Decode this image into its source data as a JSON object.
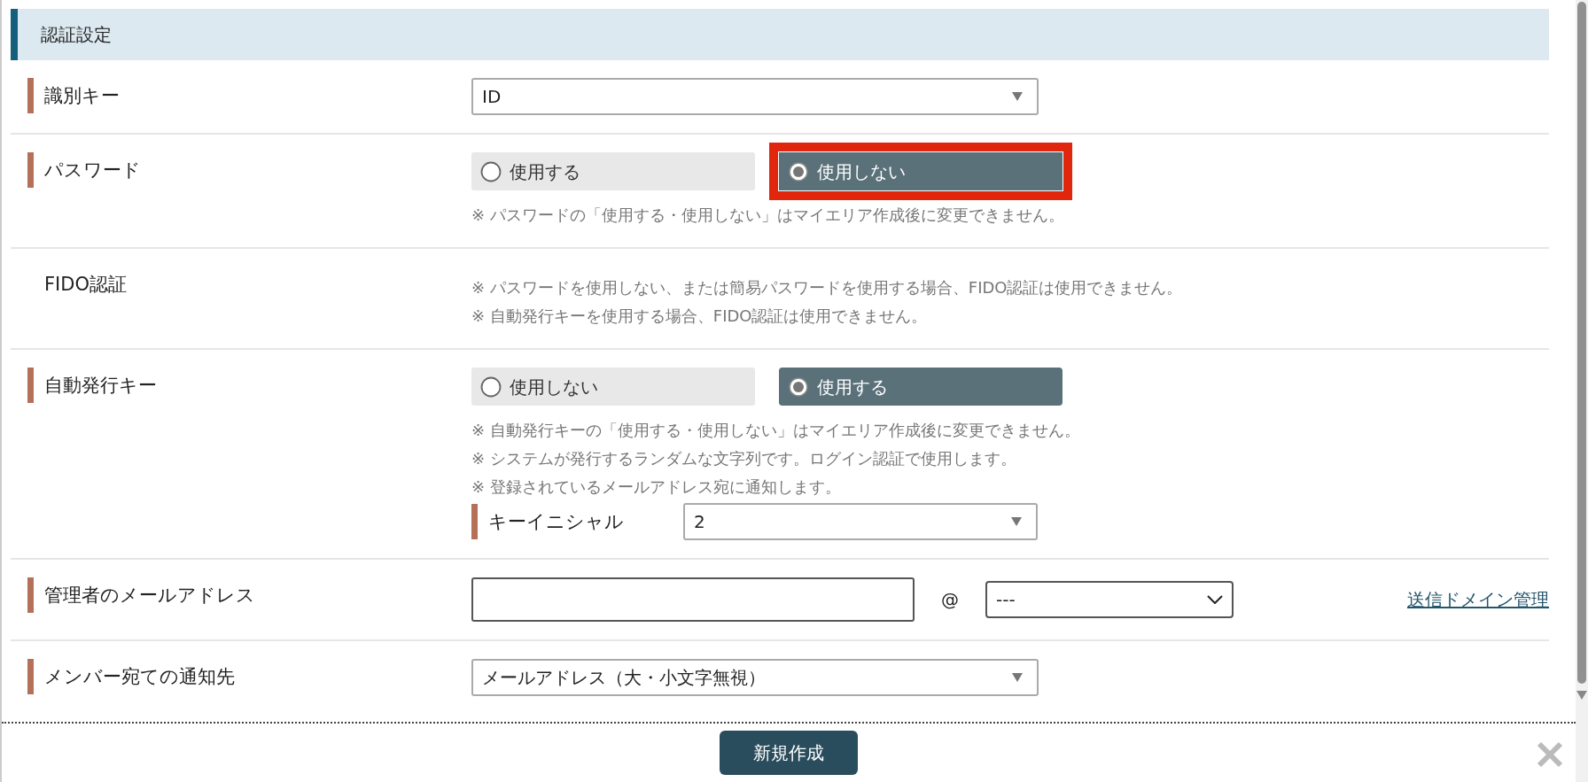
{
  "section": {
    "title": "認証設定"
  },
  "rows": [
    {
      "kind": "select",
      "label": "識別キー",
      "accent": true,
      "value": "ID"
    },
    {
      "kind": "radio",
      "label": "パスワード",
      "accent": true,
      "options": [
        {
          "label": "使用する",
          "selected": false,
          "highlighted": false
        },
        {
          "label": "使用しない",
          "selected": true,
          "highlighted": true
        }
      ],
      "notes": [
        "※ パスワードの「使用する・使用しない」はマイエリア作成後に変更できません。"
      ]
    },
    {
      "kind": "notes",
      "label": "FIDO認証",
      "accent": false,
      "notes": [
        "※ パスワードを使用しない、または簡易パスワードを使用する場合、FIDO認証は使用できません。",
        "※ 自動発行キーを使用する場合、FIDO認証は使用できません。"
      ]
    },
    {
      "kind": "radio",
      "label": "自動発行キー",
      "accent": true,
      "options": [
        {
          "label": "使用しない",
          "selected": false,
          "highlighted": false
        },
        {
          "label": "使用する",
          "selected": true,
          "highlighted": false
        }
      ],
      "notes": [
        "※ 自動発行キーの「使用する・使用しない」はマイエリア作成後に変更できません。",
        "※ システムが発行するランダムな文字列です。ログイン認証で使用します。",
        "※ 登録されているメールアドレス宛に通知します。"
      ],
      "sub_field": {
        "label": "キーイニシャル",
        "value": "2"
      }
    },
    {
      "kind": "email",
      "label": "管理者のメールアドレス",
      "accent": true,
      "at": "@",
      "domain": "---",
      "link": "送信ドメイン管理"
    },
    {
      "kind": "select",
      "label": "メンバー宛ての通知先",
      "accent": true,
      "value": "メールアドレス（大・小文字無視）"
    }
  ],
  "footer": {
    "button": "新規作成"
  }
}
